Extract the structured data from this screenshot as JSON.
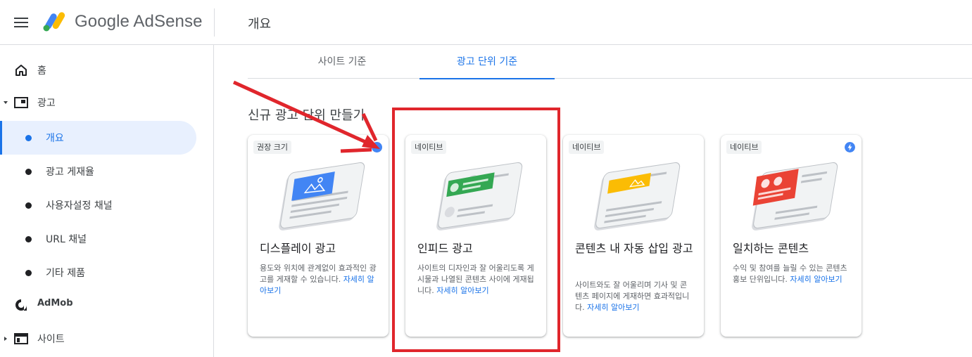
{
  "header": {
    "brand": "Google AdSense",
    "page_title": "개요"
  },
  "sidebar": {
    "items": [
      {
        "label": "홈",
        "icon": "home-icon"
      },
      {
        "label": "광고",
        "icon": "ad-unit-icon"
      },
      {
        "label": "AdMob",
        "icon": "admob-icon"
      },
      {
        "label": "사이트",
        "icon": "site-icon"
      }
    ],
    "sub_items": [
      {
        "label": "개요",
        "active": true
      },
      {
        "label": "광고 게재율"
      },
      {
        "label": "사용자설정 채널"
      },
      {
        "label": "URL 채널"
      },
      {
        "label": "기타 제품"
      }
    ]
  },
  "tabs": [
    {
      "label": "사이트 기준"
    },
    {
      "label": "광고 단위 기준",
      "active": true
    }
  ],
  "section_title": "신규 광고 단위 만들기",
  "cards": [
    {
      "chip": "권장 크기",
      "title": "디스플레이 광고",
      "desc": "용도와 위치에 관계없이 효과적인 광고를 게재할 수 있습니다.",
      "link": "자세히 알아보기",
      "accent": "#4285f4",
      "badge": "info-badge-icon"
    },
    {
      "chip": "네이티브",
      "title": "인피드 광고",
      "desc": "사이트의 디자인과 잘 어울리도록 게시물과 나열된 콘텐츠 사이에 게재됩니다.",
      "link": "자세히 알아보기",
      "accent": "#34a853"
    },
    {
      "chip": "네이티브",
      "title": "콘텐츠 내 자동 삽입 광고",
      "desc": "사이트와도 잘 어울리며 기사 및 콘텐츠 페이지에 게재하면 효과적입니다.",
      "link": "자세히 알아보기",
      "accent": "#fbbc04"
    },
    {
      "chip": "네이티브",
      "title": "일치하는 콘텐츠",
      "desc": "수익 및 참여를 늘릴 수 있는 콘텐츠 홍보 단위입니다.",
      "link": "자세히 알아보기",
      "accent": "#ea4335",
      "badge": "lightning-bolt-icon"
    }
  ],
  "colors": {
    "primary": "#1a73e8",
    "highlight": "#e0262c"
  }
}
